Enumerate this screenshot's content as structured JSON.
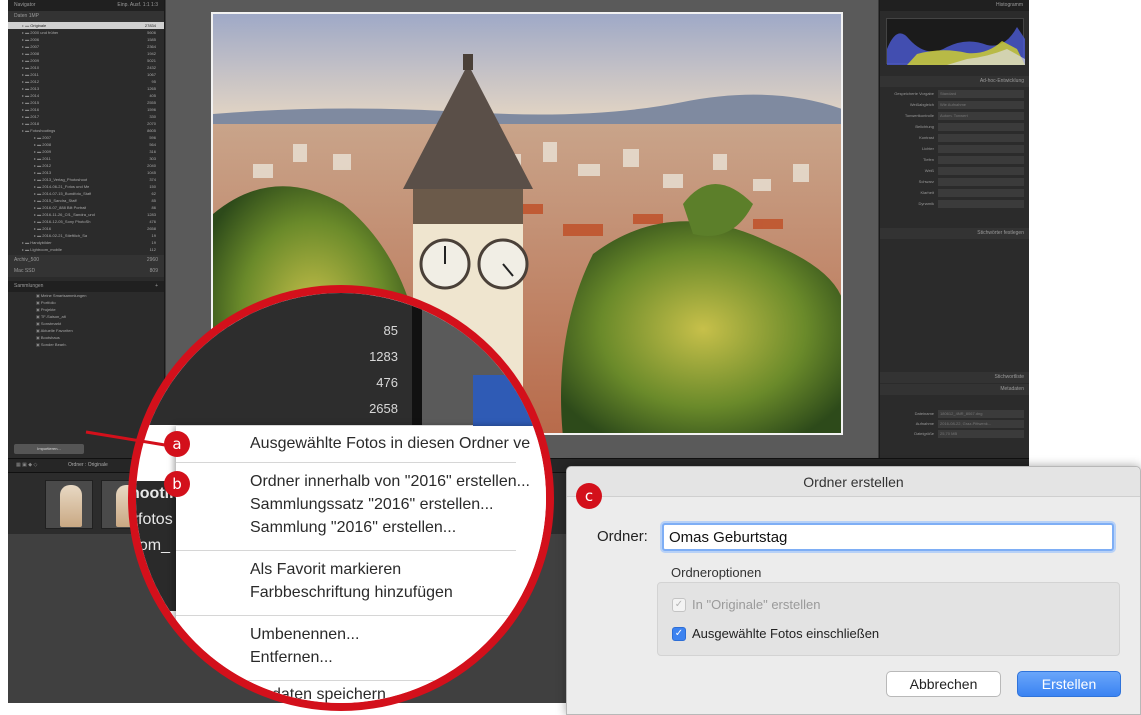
{
  "lightroom": {
    "navigator_title": "Navigator",
    "navigator_modes": "Einp.  Ausf.  1:1  1:3",
    "catalog_head": "Katalog",
    "folders_head": "Ordner",
    "drive_main": "Daten 1MP",
    "folders": [
      {
        "name": "Originale",
        "count": "27834",
        "sel": true
      },
      {
        "name": "2000 und früher",
        "count": "5606"
      },
      {
        "name": "2006",
        "count": "1585"
      },
      {
        "name": "2007",
        "count": "2364"
      },
      {
        "name": "2008",
        "count": "1942"
      },
      {
        "name": "2009",
        "count": "5021"
      },
      {
        "name": "2010",
        "count": "2432"
      },
      {
        "name": "2011",
        "count": "1067"
      },
      {
        "name": "2012",
        "count": "95"
      },
      {
        "name": "2013",
        "count": "1265"
      },
      {
        "name": "2014",
        "count": "405"
      },
      {
        "name": "2015",
        "count": "2555"
      },
      {
        "name": "2016",
        "count": "1596"
      },
      {
        "name": "2017",
        "count": "330"
      },
      {
        "name": "2018",
        "count": "2070"
      },
      {
        "name": "Fotoshootings",
        "count": "8605"
      },
      {
        "name": "2007",
        "count": "596"
      },
      {
        "name": "2008",
        "count": "564"
      },
      {
        "name": "2009",
        "count": "316"
      },
      {
        "name": "2011",
        "count": "303"
      },
      {
        "name": "2012",
        "count": "2040"
      },
      {
        "name": "2013",
        "count": "1045"
      },
      {
        "name": "2013_Verlag_Photoshoot",
        "count": "374"
      },
      {
        "name": "2014-06-21_Fotos und Me",
        "count": "150"
      },
      {
        "name": "2014-07-15_Bundfoto_Staff",
        "count": "62"
      },
      {
        "name": "2015_Sandra_Staff",
        "count": "85"
      },
      {
        "name": "2016-07_888 Bilt Portrait",
        "count": "86"
      },
      {
        "name": "2016-11-26_Cf1_Sandra_und",
        "count": "1283"
      },
      {
        "name": "2016-12-05_Sony PhotoSh",
        "count": "476"
      },
      {
        "name": "2016",
        "count": "2658"
      },
      {
        "name": "2016-02-21_Stieftlich_Sa",
        "count": "19"
      },
      {
        "name": "Handybilder",
        "count": "19"
      },
      {
        "name": "Lightroom_mobile",
        "count": "112"
      }
    ],
    "drive_2": "Archiv_500",
    "drive_2_count": "2960",
    "drive_3": "Mac SSD",
    "drive_3_count": "809",
    "collections_head": "Sammlungen",
    "collections": [
      "Meine Smartsammlungen",
      "Portfolio",
      "Projekte",
      "TF-Saison_alt",
      "Sonstmarkt",
      "Aktuelle Favoriten",
      "Bootshaus",
      "Sonder Bearb."
    ],
    "import_button": "Importieren...",
    "export_button": "Exportieren...",
    "toolbar_path": "Ordner : Originale",
    "right_panel_title": "Histogramm",
    "quick_develop": "Ad-hoc-Entwicklung",
    "right_rows": [
      {
        "k": "Gespeicherte Vorgabe",
        "v": "Standard"
      },
      {
        "k": "Weißabgleich",
        "v": "Wie Aufnahme"
      },
      {
        "k": "Tonwertkontrolle",
        "v": "Autom. Tonwert"
      },
      {
        "k": "Belichtung",
        "v": ""
      },
      {
        "k": "Kontrast",
        "v": ""
      },
      {
        "k": "Lichter",
        "v": ""
      },
      {
        "k": "Tiefen",
        "v": ""
      },
      {
        "k": "Weiß",
        "v": ""
      },
      {
        "k": "Schwarz",
        "v": ""
      },
      {
        "k": "Klarheit",
        "v": ""
      },
      {
        "k": "Dynamik",
        "v": ""
      }
    ],
    "keywords_title": "Stichwörter festlegen",
    "keyword_list_title": "Stichwortliste",
    "metadata_title": "Metadaten",
    "metadata_rows": [
      {
        "k": "Dateiname",
        "v": "180612_4NR_8067.dng"
      },
      {
        "k": "Aufnahme",
        "v": "2016-08-22, Graz-Pittwenk..."
      },
      {
        "k": "Dateigröße",
        "v": "25,70 MB"
      }
    ],
    "filmstrip_labels": [
      "hootin",
      "vfotos",
      "oom_"
    ],
    "magnified_counts": [
      "85",
      "1283",
      "476",
      "2658"
    ]
  },
  "context_menu": {
    "items": [
      {
        "label": "Ausgewählte Fotos in diesen Ordner ve",
        "marker": "a"
      },
      {
        "label": "Ordner innerhalb von \"2016\" erstellen...",
        "marker": "b"
      },
      {
        "label": "Sammlungssatz \"2016\" erstellen..."
      },
      {
        "label": "Sammlung \"2016\" erstellen..."
      },
      {
        "label": "Als Favorit markieren"
      },
      {
        "label": "Farbbeschriftung hinzufügen"
      },
      {
        "label": "Umbenennen..."
      },
      {
        "label": "Entfernen..."
      },
      {
        "label": "daten speichern"
      }
    ]
  },
  "dialog": {
    "marker": "c",
    "title": "Ordner erstellen",
    "folder_label": "Ordner:",
    "folder_value": "Omas Geburtstag",
    "options_label": "Ordneroptionen",
    "option_1": "In \"Originale\" erstellen",
    "option_1_checked": true,
    "option_1_disabled": true,
    "option_2": "Ausgewählte Fotos einschließen",
    "option_2_checked": true,
    "cancel_label": "Abbrechen",
    "create_label": "Erstellen"
  },
  "colors": {
    "marker_red": "#d3101b",
    "accent_blue": "#3d83f0"
  }
}
